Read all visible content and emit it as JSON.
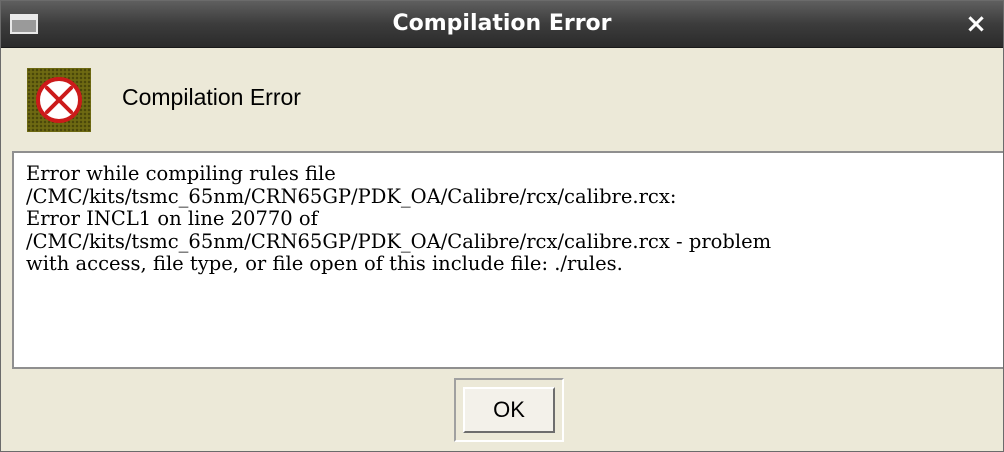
{
  "window": {
    "title": "Compilation Error",
    "close_glyph": "×",
    "menu_icon": "window-menu-icon"
  },
  "header": {
    "icon": "error-circle-x-icon",
    "label": "Compilation Error"
  },
  "message": {
    "lines": [
      "Error while compiling rules file",
      "/CMC/kits/tsmc_65nm/CRN65GP/PDK_OA/Calibre/rcx/calibre.rcx:",
      "Error INCL1 on line 20770 of",
      "/CMC/kits/tsmc_65nm/CRN65GP/PDK_OA/Calibre/rcx/calibre.rcx - problem",
      "with access, file type, or file open of this include file: ./rules."
    ]
  },
  "buttons": {
    "ok_label": "OK"
  },
  "colors": {
    "titlebar": "#3c3c3c",
    "dialog_bg": "#ece9d8",
    "icon_red": "#cc1a1a"
  }
}
